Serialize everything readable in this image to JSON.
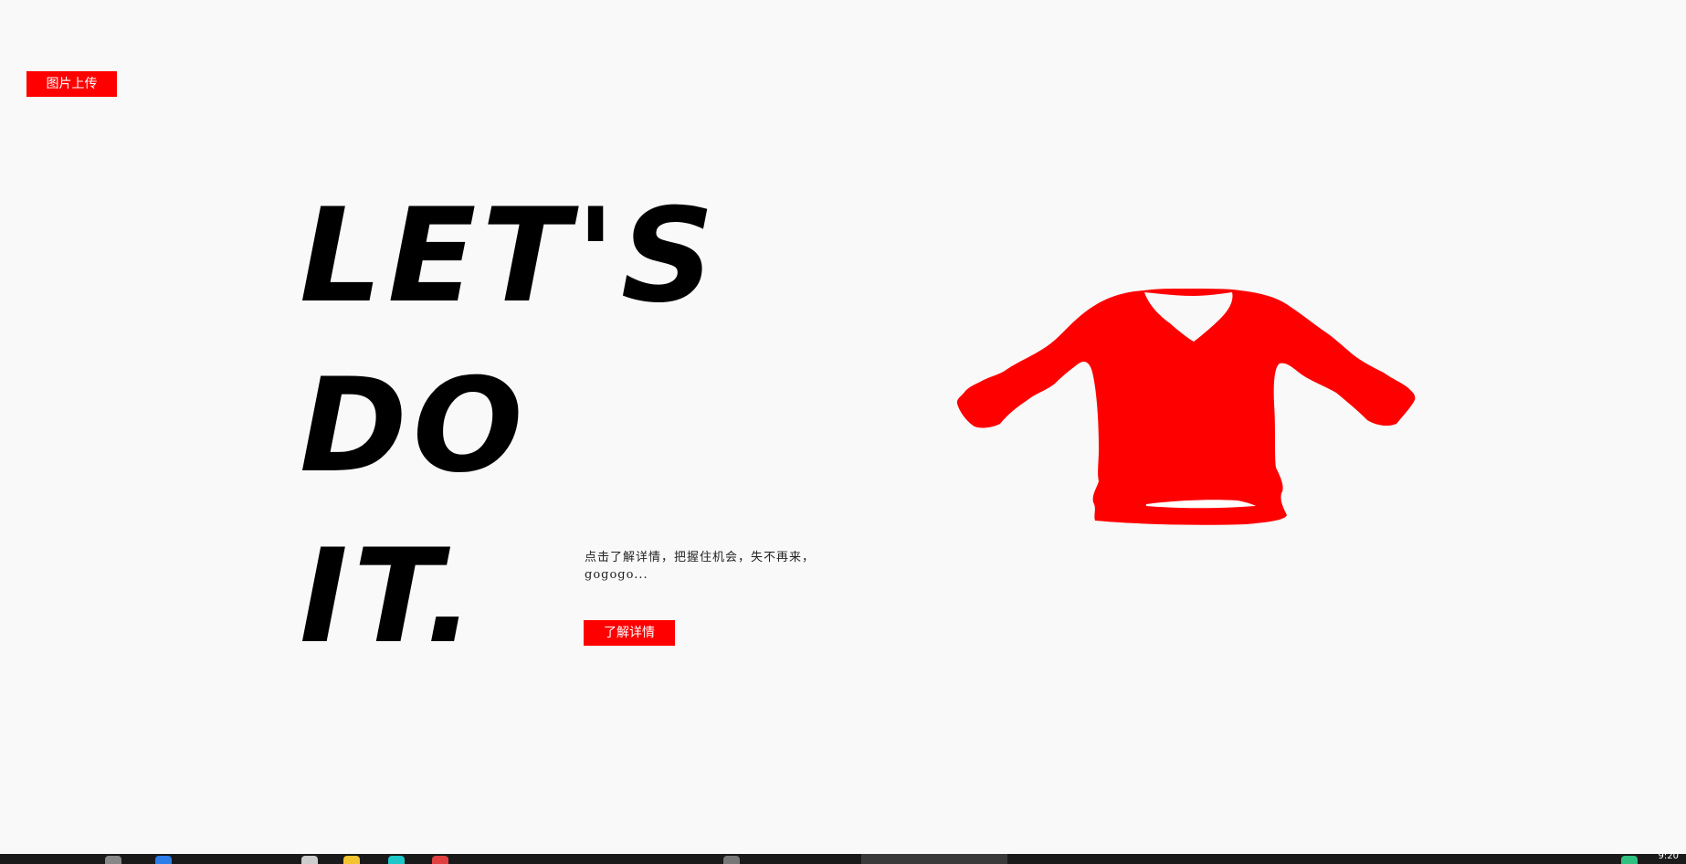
{
  "upload_button": {
    "label": "图片上传"
  },
  "hero": {
    "headline_lines": [
      "LET'S",
      "DO",
      "IT."
    ],
    "description": "点击了解详情，把握住机会，失不再来，gogogo...",
    "detail_button": {
      "label": "了解详情"
    }
  },
  "product": {
    "image_name": "red-sweater-image",
    "color": "#ff0000"
  },
  "colors": {
    "accent": "#ff0000",
    "background": "#f9f9f9",
    "text": "#000000"
  },
  "taskbar": {
    "clock": "9:20"
  }
}
